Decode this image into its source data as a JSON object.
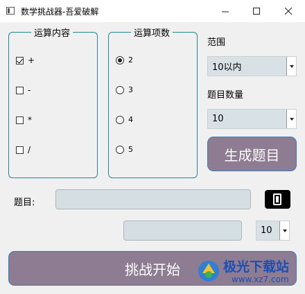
{
  "window": {
    "title": "数学挑战器-吾爱破解",
    "icons": [
      "app-icon",
      "minimize-icon",
      "maximize-icon",
      "close-icon"
    ]
  },
  "operations_group": {
    "title": "运算内容",
    "items": [
      {
        "label": "+",
        "checked": true
      },
      {
        "label": "-",
        "checked": false
      },
      {
        "label": "*",
        "checked": false
      },
      {
        "label": "/",
        "checked": false
      }
    ]
  },
  "terms_group": {
    "title": "运算项数",
    "items": [
      {
        "label": "2",
        "selected": true
      },
      {
        "label": "3",
        "selected": false
      },
      {
        "label": "4",
        "selected": false
      },
      {
        "label": "5",
        "selected": false
      }
    ]
  },
  "range": {
    "label": "范围",
    "value": "10以内"
  },
  "count": {
    "label": "题目数量",
    "value": "10"
  },
  "generate_button": "生成题目",
  "question": {
    "label": "题目:",
    "value": ""
  },
  "answer": {
    "value": ""
  },
  "timer_combo": {
    "value": "10"
  },
  "start_button": "挑战开始",
  "watermark": {
    "text": "极光下载站",
    "url": "www.xz7.com"
  },
  "colors": {
    "group_border": "#1f8a8a",
    "button_fill": "#8e7c92",
    "button_border": "#3b7dbf",
    "field_fill": "#d5dfe3",
    "watermark": "#1a4fb5"
  }
}
